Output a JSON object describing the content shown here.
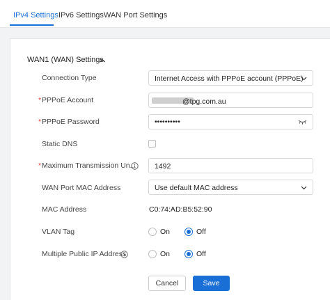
{
  "tabs": [
    {
      "label": "IPv4 Settings",
      "active": true
    },
    {
      "label": "IPv6 Settings",
      "active": false
    },
    {
      "label": "WAN Port Settings",
      "active": false
    }
  ],
  "section": {
    "title": "WAN1 (WAN) Settings",
    "icon": "chevron-up-icon"
  },
  "fields": {
    "connection_type": {
      "label": "Connection Type",
      "value": "Internet Access with PPPoE account (PPPoE)"
    },
    "pppoe_account": {
      "label": "PPPoE Account",
      "required_mark": "*",
      "value_suffix": "@tpg.com.au"
    },
    "pppoe_password": {
      "label": "PPPoE Password",
      "required_mark": "*",
      "value": "••••••••••"
    },
    "static_dns": {
      "label": "Static DNS",
      "checked": false
    },
    "mtu": {
      "label": "Maximum Transmission Un...",
      "required_mark": "*",
      "value": "1492"
    },
    "wan_port_mac": {
      "label": "WAN Port MAC Address",
      "value": "Use default MAC address"
    },
    "mac_address": {
      "label": "MAC Address",
      "value": "C0:74:AD:B5:52:90"
    },
    "vlan_tag": {
      "label": "VLAN Tag",
      "on_label": "On",
      "off_label": "Off",
      "selected": "Off"
    },
    "multiple_public_ip": {
      "label": "Multiple Public IP Address",
      "on_label": "On",
      "off_label": "Off",
      "selected": "Off"
    }
  },
  "buttons": {
    "cancel": "Cancel",
    "save": "Save"
  },
  "colors": {
    "accent": "#1a6fd6",
    "required": "#e53935"
  }
}
